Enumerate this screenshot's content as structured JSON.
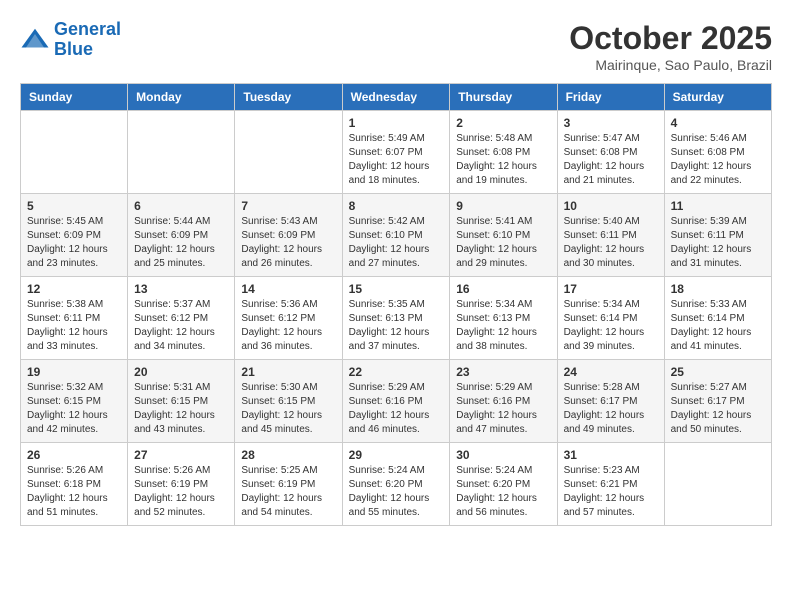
{
  "header": {
    "logo_line1": "General",
    "logo_line2": "Blue",
    "month_title": "October 2025",
    "location": "Mairinque, Sao Paulo, Brazil"
  },
  "weekdays": [
    "Sunday",
    "Monday",
    "Tuesday",
    "Wednesday",
    "Thursday",
    "Friday",
    "Saturday"
  ],
  "weeks": [
    [
      {
        "day": "",
        "info": ""
      },
      {
        "day": "",
        "info": ""
      },
      {
        "day": "",
        "info": ""
      },
      {
        "day": "1",
        "info": "Sunrise: 5:49 AM\nSunset: 6:07 PM\nDaylight: 12 hours\nand 18 minutes."
      },
      {
        "day": "2",
        "info": "Sunrise: 5:48 AM\nSunset: 6:08 PM\nDaylight: 12 hours\nand 19 minutes."
      },
      {
        "day": "3",
        "info": "Sunrise: 5:47 AM\nSunset: 6:08 PM\nDaylight: 12 hours\nand 21 minutes."
      },
      {
        "day": "4",
        "info": "Sunrise: 5:46 AM\nSunset: 6:08 PM\nDaylight: 12 hours\nand 22 minutes."
      }
    ],
    [
      {
        "day": "5",
        "info": "Sunrise: 5:45 AM\nSunset: 6:09 PM\nDaylight: 12 hours\nand 23 minutes."
      },
      {
        "day": "6",
        "info": "Sunrise: 5:44 AM\nSunset: 6:09 PM\nDaylight: 12 hours\nand 25 minutes."
      },
      {
        "day": "7",
        "info": "Sunrise: 5:43 AM\nSunset: 6:09 PM\nDaylight: 12 hours\nand 26 minutes."
      },
      {
        "day": "8",
        "info": "Sunrise: 5:42 AM\nSunset: 6:10 PM\nDaylight: 12 hours\nand 27 minutes."
      },
      {
        "day": "9",
        "info": "Sunrise: 5:41 AM\nSunset: 6:10 PM\nDaylight: 12 hours\nand 29 minutes."
      },
      {
        "day": "10",
        "info": "Sunrise: 5:40 AM\nSunset: 6:11 PM\nDaylight: 12 hours\nand 30 minutes."
      },
      {
        "day": "11",
        "info": "Sunrise: 5:39 AM\nSunset: 6:11 PM\nDaylight: 12 hours\nand 31 minutes."
      }
    ],
    [
      {
        "day": "12",
        "info": "Sunrise: 5:38 AM\nSunset: 6:11 PM\nDaylight: 12 hours\nand 33 minutes."
      },
      {
        "day": "13",
        "info": "Sunrise: 5:37 AM\nSunset: 6:12 PM\nDaylight: 12 hours\nand 34 minutes."
      },
      {
        "day": "14",
        "info": "Sunrise: 5:36 AM\nSunset: 6:12 PM\nDaylight: 12 hours\nand 36 minutes."
      },
      {
        "day": "15",
        "info": "Sunrise: 5:35 AM\nSunset: 6:13 PM\nDaylight: 12 hours\nand 37 minutes."
      },
      {
        "day": "16",
        "info": "Sunrise: 5:34 AM\nSunset: 6:13 PM\nDaylight: 12 hours\nand 38 minutes."
      },
      {
        "day": "17",
        "info": "Sunrise: 5:34 AM\nSunset: 6:14 PM\nDaylight: 12 hours\nand 39 minutes."
      },
      {
        "day": "18",
        "info": "Sunrise: 5:33 AM\nSunset: 6:14 PM\nDaylight: 12 hours\nand 41 minutes."
      }
    ],
    [
      {
        "day": "19",
        "info": "Sunrise: 5:32 AM\nSunset: 6:15 PM\nDaylight: 12 hours\nand 42 minutes."
      },
      {
        "day": "20",
        "info": "Sunrise: 5:31 AM\nSunset: 6:15 PM\nDaylight: 12 hours\nand 43 minutes."
      },
      {
        "day": "21",
        "info": "Sunrise: 5:30 AM\nSunset: 6:15 PM\nDaylight: 12 hours\nand 45 minutes."
      },
      {
        "day": "22",
        "info": "Sunrise: 5:29 AM\nSunset: 6:16 PM\nDaylight: 12 hours\nand 46 minutes."
      },
      {
        "day": "23",
        "info": "Sunrise: 5:29 AM\nSunset: 6:16 PM\nDaylight: 12 hours\nand 47 minutes."
      },
      {
        "day": "24",
        "info": "Sunrise: 5:28 AM\nSunset: 6:17 PM\nDaylight: 12 hours\nand 49 minutes."
      },
      {
        "day": "25",
        "info": "Sunrise: 5:27 AM\nSunset: 6:17 PM\nDaylight: 12 hours\nand 50 minutes."
      }
    ],
    [
      {
        "day": "26",
        "info": "Sunrise: 5:26 AM\nSunset: 6:18 PM\nDaylight: 12 hours\nand 51 minutes."
      },
      {
        "day": "27",
        "info": "Sunrise: 5:26 AM\nSunset: 6:19 PM\nDaylight: 12 hours\nand 52 minutes."
      },
      {
        "day": "28",
        "info": "Sunrise: 5:25 AM\nSunset: 6:19 PM\nDaylight: 12 hours\nand 54 minutes."
      },
      {
        "day": "29",
        "info": "Sunrise: 5:24 AM\nSunset: 6:20 PM\nDaylight: 12 hours\nand 55 minutes."
      },
      {
        "day": "30",
        "info": "Sunrise: 5:24 AM\nSunset: 6:20 PM\nDaylight: 12 hours\nand 56 minutes."
      },
      {
        "day": "31",
        "info": "Sunrise: 5:23 AM\nSunset: 6:21 PM\nDaylight: 12 hours\nand 57 minutes."
      },
      {
        "day": "",
        "info": ""
      }
    ]
  ]
}
